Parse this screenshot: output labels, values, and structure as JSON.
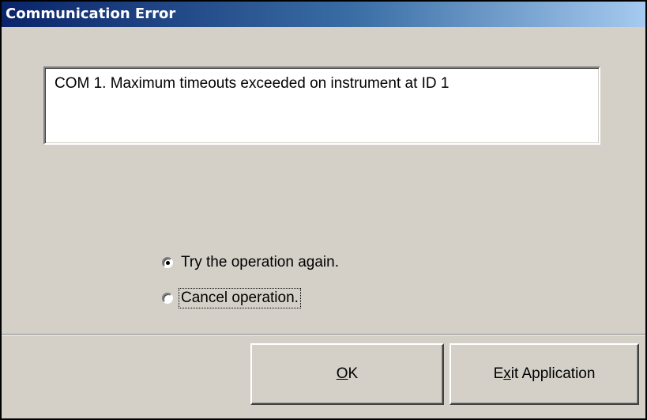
{
  "window": {
    "title": "Communication Error"
  },
  "message": {
    "text": "COM 1. Maximum timeouts exceeded on instrument at ID 1"
  },
  "options": [
    {
      "label": "Try the operation again.",
      "selected": true
    },
    {
      "label": "Cancel operation.",
      "selected": false,
      "focused": true
    }
  ],
  "buttons": {
    "ok": {
      "prefix": "",
      "mnemonic": "O",
      "suffix": "K"
    },
    "exit": {
      "prefix": "E",
      "mnemonic": "x",
      "suffix": "it Application"
    }
  },
  "colors": {
    "face": "#d4d0c8",
    "title_start": "#0a246a",
    "title_end": "#a6caf0"
  }
}
